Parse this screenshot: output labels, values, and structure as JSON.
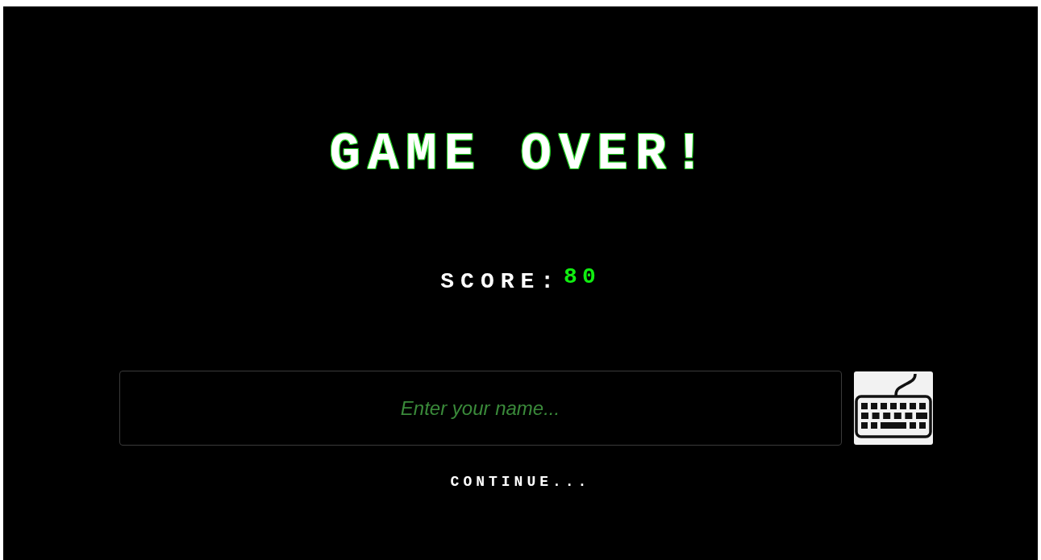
{
  "title": "GAME OVER!",
  "score": {
    "label": "SCORE:",
    "value": "80"
  },
  "name_field": {
    "placeholder": "Enter your name..."
  },
  "continue_link": "CONTINUE..."
}
